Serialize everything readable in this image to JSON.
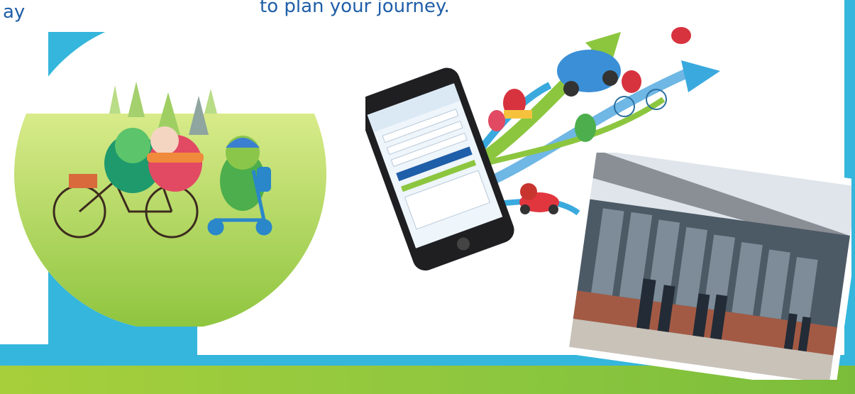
{
  "texts": {
    "left_fragment": "ay",
    "top_fragment": "to plan your journey."
  },
  "colors": {
    "text_blue": "#1f5ea8",
    "cyan": "#35b6dc",
    "lime": "#8cc63f"
  },
  "illustrations": {
    "circle": "birds-riding-bike-and-scooter",
    "phone": "journey-planner-smartphone-with-arrows",
    "photo": "school-building-with-students"
  }
}
